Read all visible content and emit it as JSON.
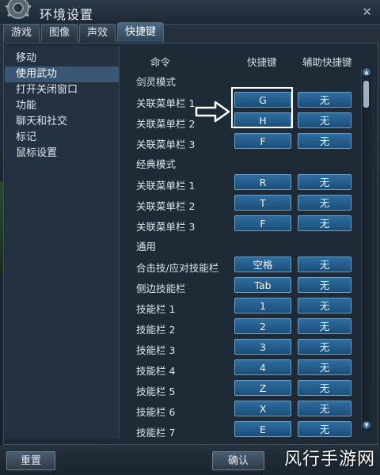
{
  "window": {
    "title": "环境设置"
  },
  "tabs": [
    {
      "label": "游戏"
    },
    {
      "label": "图像"
    },
    {
      "label": "声效"
    },
    {
      "label": "快捷键",
      "active": true
    }
  ],
  "sidebar": {
    "items": [
      {
        "label": "移动"
      },
      {
        "label": "使用武功",
        "active": true
      },
      {
        "label": "打开关闭窗口"
      },
      {
        "label": "功能"
      },
      {
        "label": "聊天和社交"
      },
      {
        "label": "标记"
      },
      {
        "label": "鼠标设置"
      }
    ]
  },
  "table": {
    "headers": {
      "command": "命令",
      "shortcut": "快捷键",
      "aux_shortcut": "辅助快捷键"
    },
    "rows": [
      {
        "type": "section",
        "label": "剑灵模式"
      },
      {
        "type": "binding",
        "label": "关联菜单栏 1",
        "key": "G",
        "aux": "无"
      },
      {
        "type": "binding",
        "label": "关联菜单栏 2",
        "key": "H",
        "aux": "无"
      },
      {
        "type": "binding",
        "label": "关联菜单栏 3",
        "key": "F",
        "aux": "无"
      },
      {
        "type": "section",
        "label": "经典模式"
      },
      {
        "type": "binding",
        "label": "关联菜单栏 1",
        "key": "R",
        "aux": "无"
      },
      {
        "type": "binding",
        "label": "关联菜单栏 2",
        "key": "T",
        "aux": "无"
      },
      {
        "type": "binding",
        "label": "关联菜单栏 3",
        "key": "F",
        "aux": "无"
      },
      {
        "type": "section",
        "label": "通用"
      },
      {
        "type": "binding",
        "label": "合击技/应对技能栏",
        "key": "空格",
        "aux": "无"
      },
      {
        "type": "binding",
        "label": "侧边技能栏",
        "key": "Tab",
        "aux": "无"
      },
      {
        "type": "binding",
        "label": "技能栏 1",
        "key": "1",
        "aux": "无"
      },
      {
        "type": "binding",
        "label": "技能栏 2",
        "key": "2",
        "aux": "无"
      },
      {
        "type": "binding",
        "label": "技能栏 3",
        "key": "3",
        "aux": "无"
      },
      {
        "type": "binding",
        "label": "技能栏 4",
        "key": "4",
        "aux": "无"
      },
      {
        "type": "binding",
        "label": "技能栏 5",
        "key": "Z",
        "aux": "无"
      },
      {
        "type": "binding",
        "label": "技能栏 6",
        "key": "X",
        "aux": "无"
      },
      {
        "type": "binding",
        "label": "技能栏 7",
        "key": "E",
        "aux": "无"
      }
    ]
  },
  "footer": {
    "reset_label": "重置",
    "confirm_label": "确认"
  },
  "watermark": "风行手游网",
  "icons": {
    "gear": "gear-icon",
    "close": "close-icon",
    "arrow": "arrow-right-icon",
    "scroll_up": "scroll-up-icon",
    "scroll_down": "scroll-down-icon"
  },
  "colors": {
    "key_button": "#1b4f7a",
    "highlight": "#ffffff",
    "active_tab": "#2e465a"
  }
}
